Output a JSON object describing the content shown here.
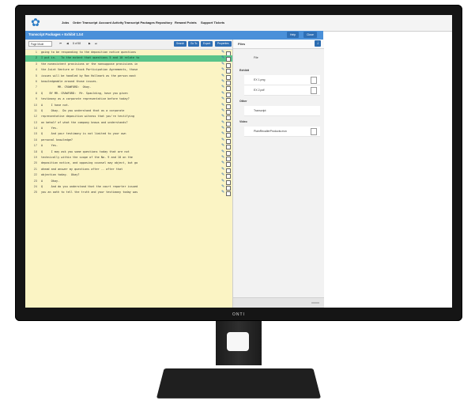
{
  "monitor": {
    "brand": "ONTI"
  },
  "nav": {
    "items": [
      "Jobs",
      "Order Transcript",
      "Account Activity",
      "Transcript Packages",
      "Repository",
      "Reward Points",
      "Support Tickets"
    ]
  },
  "title": {
    "text": "Transcript Packages » Exhibit 1.txt",
    "help_label": "Help",
    "close_label": "Close"
  },
  "toolbar": {
    "view_select": "Page Mode",
    "page_display": "8 of 58",
    "search_label": "Search",
    "goto_label": "Go To",
    "export_label": "Export",
    "properties_label": "Properties"
  },
  "transcript": {
    "highlighted_line": 2,
    "lines": [
      {
        "n": "1",
        "text": "going to be responding to the deposition notice questions"
      },
      {
        "n": "2",
        "text": "I put in.   To the extent that questions 5 and 10 relate to"
      },
      {
        "n": "3",
        "text": "the nonexistent provisions or the nonsuppose provisions in"
      },
      {
        "n": "4",
        "text": "the Joint Venture or Stock Participation Agreements, those"
      },
      {
        "n": "5",
        "text": "issues will be handled by Ron Hollmark as the person most"
      },
      {
        "n": "6",
        "text": "knowledgeable around those issues."
      },
      {
        "n": "7",
        "text": "          MR. CRAWFORD:  Okay."
      },
      {
        "n": "8",
        "text": "Q    BY MR. CRAWFORD:  Mr. Spaulding, have you given"
      },
      {
        "n": "9",
        "text": "testimony as a corporate representative before today?"
      },
      {
        "n": "10",
        "text": "A     I have not."
      },
      {
        "n": "11",
        "text": "Q     Okay.  Do you understand that as a corporate"
      },
      {
        "n": "12",
        "text": "representative deposition witness that you're testifying"
      },
      {
        "n": "13",
        "text": "on behalf of what the company knows and understands?"
      },
      {
        "n": "14",
        "text": "A     Yes."
      },
      {
        "n": "15",
        "text": "Q     And your testimony is not limited to your own"
      },
      {
        "n": "16",
        "text": "personal knowledge?"
      },
      {
        "n": "17",
        "text": "A     Yes."
      },
      {
        "n": "18",
        "text": "Q     I may ask you some questions today that are not"
      },
      {
        "n": "19",
        "text": "technically within the scope of the No. 9 and 10 on the"
      },
      {
        "n": "20",
        "text": "deposition notice, and opposing counsel may object, but go"
      },
      {
        "n": "21",
        "text": "ahead and answer my questions after -- after that"
      },
      {
        "n": "22",
        "text": "objection today.  Okay?"
      },
      {
        "n": "23",
        "text": "A     Okay."
      },
      {
        "n": "24",
        "text": "Q     And do you understand that the court reporter issued"
      },
      {
        "n": "25",
        "text": "you an oath to tell the truth and your testimony today was"
      }
    ]
  },
  "files_panel": {
    "title": "Files",
    "top_file": "File",
    "groups": [
      {
        "label": "Exhibit",
        "files": [
          "EX 1.png",
          "EX 2.pdf"
        ]
      },
      {
        "label": "Other",
        "files": [
          "Transcript"
        ]
      },
      {
        "label": "Video",
        "files": [
          "PlainRecallerProducts.mov"
        ]
      }
    ]
  }
}
